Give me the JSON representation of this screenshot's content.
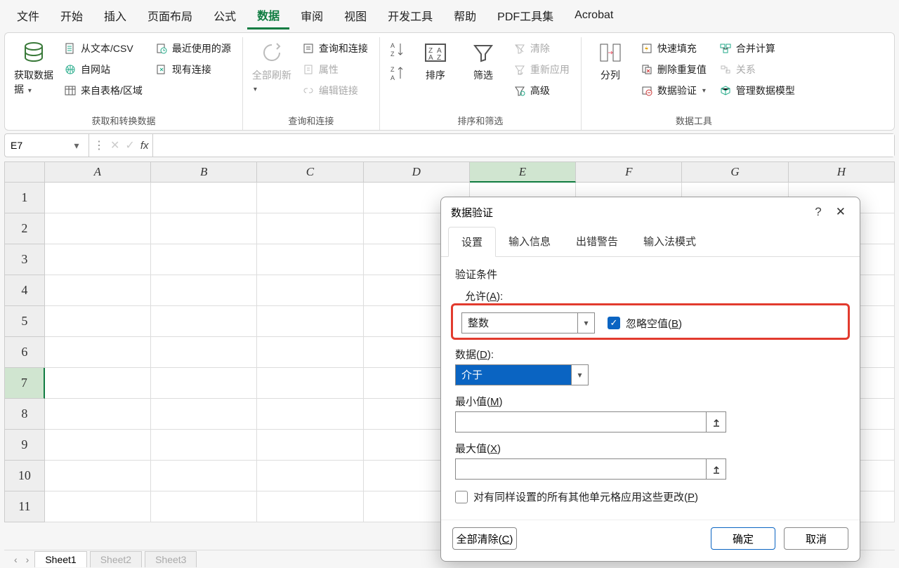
{
  "tabs": [
    "文件",
    "开始",
    "插入",
    "页面布局",
    "公式",
    "数据",
    "审阅",
    "视图",
    "开发工具",
    "帮助",
    "PDF工具集",
    "Acrobat"
  ],
  "active_tab_index": 5,
  "ribbon": {
    "group1": {
      "big": "获取数据",
      "items": [
        "从文本/CSV",
        "自网站",
        "来自表格/区域",
        "最近使用的源",
        "现有连接"
      ],
      "label": "获取和转换数据"
    },
    "group2": {
      "big": "全部刷新",
      "items": [
        "查询和连接",
        "属性",
        "编辑链接"
      ],
      "label": "查询和连接"
    },
    "group3": {
      "sort": "排序",
      "filter": "筛选",
      "items": [
        "清除",
        "重新应用",
        "高级"
      ],
      "label": "排序和筛选"
    },
    "group4": {
      "big": "分列",
      "items": [
        "快速填充",
        "删除重复值",
        "数据验证",
        "合并计算",
        "关系",
        "管理数据模型"
      ],
      "label": "数据工具"
    }
  },
  "formula_bar": {
    "cell_ref": "E7",
    "formula": ""
  },
  "columns": [
    "A",
    "B",
    "C",
    "D",
    "E",
    "F",
    "G",
    "H"
  ],
  "rows": [
    "1",
    "2",
    "3",
    "4",
    "5",
    "6",
    "7",
    "8",
    "9",
    "10",
    "11"
  ],
  "active_col_index": 4,
  "active_row_index": 6,
  "sheets": {
    "active": "Sheet1",
    "others": [
      "Sheet2",
      "Sheet3"
    ]
  },
  "dialog": {
    "title": "数据验证",
    "tabs": [
      "设置",
      "输入信息",
      "出错警告",
      "输入法模式"
    ],
    "active_tab_index": 0,
    "section_label": "验证条件",
    "allow_label_pre": "允许(",
    "allow_label_u": "A",
    "allow_label_post": "):",
    "allow_value": "整数",
    "ignore_blank_pre": "忽略空值(",
    "ignore_blank_u": "B",
    "ignore_blank_post": ")",
    "ignore_blank_checked": true,
    "data_label_pre": "数据(",
    "data_label_u": "D",
    "data_label_post": "):",
    "data_value": "介于",
    "min_label_pre": "最小值(",
    "min_label_u": "M",
    "min_label_post": ")",
    "min_value": "",
    "max_label_pre": "最大值(",
    "max_label_u": "X",
    "max_label_post": ")",
    "max_value": "",
    "apply_all_pre": "对有同样设置的所有其他单元格应用这些更改(",
    "apply_all_u": "P",
    "apply_all_post": ")",
    "clear_all_pre": "全部清除(",
    "clear_all_u": "C",
    "clear_all_post": ")",
    "ok": "确定",
    "cancel": "取消"
  }
}
